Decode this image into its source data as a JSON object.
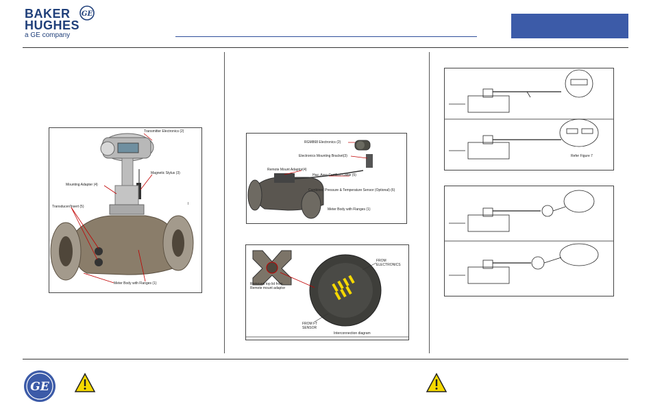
{
  "brand": {
    "line1": "BAKER",
    "line2": "HUGHES",
    "tagline": "a GE company",
    "ge_monogram": "GE"
  },
  "colors": {
    "brand_blue": "#1f3f7a",
    "title_box": "#3c5ba8",
    "meter_metal": "#8a7d6a",
    "warning_yellow": "#f5d800"
  },
  "figure1": {
    "labels": {
      "transmitter": "Transmitter Electronics (2)",
      "stylus": "Magnetic Stylus (3)",
      "mounting": "Mounting Adapter (4)",
      "transducer": "Transducer/Insert (5)",
      "body": "Meter Body with Flanges (1)",
      "marker": "I"
    }
  },
  "figure2": {
    "labels": {
      "electronics": "RGM868 Electronics (2)",
      "bracket": "Electronics Mounting Bracket(3)",
      "adaptor": "Remote Mount Adaptor(4)",
      "cable": "Haz. Area Certified Cable (5)",
      "sensor": "Combined Pressure & Temperature Sensor (Optional) (6)",
      "body": "Meter Body with Flanges (1)"
    }
  },
  "figure3": {
    "labels": {
      "removed_lid": "Removed top lid from Remote mount adaptor",
      "from_electronics": "FROM ELECTRONICS",
      "from_sensor": "FROM FT SENSOR",
      "diagram": "Interconnection diagram"
    }
  },
  "figure4": {
    "labels": {
      "refer": "Refer Figure 7"
    }
  },
  "footer": {
    "ge_logo": "GE"
  }
}
